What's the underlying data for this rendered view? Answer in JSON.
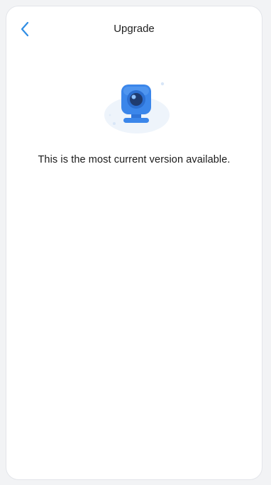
{
  "header": {
    "title": "Upgrade",
    "back_icon": "chevron-left-icon"
  },
  "main": {
    "illustration_icon": "camera-icon",
    "status_message": "This is the most current version available."
  },
  "colors": {
    "accent": "#2f8de4",
    "camera_blue": "#3b86ea",
    "camera_lens": "#1f3b6f"
  }
}
